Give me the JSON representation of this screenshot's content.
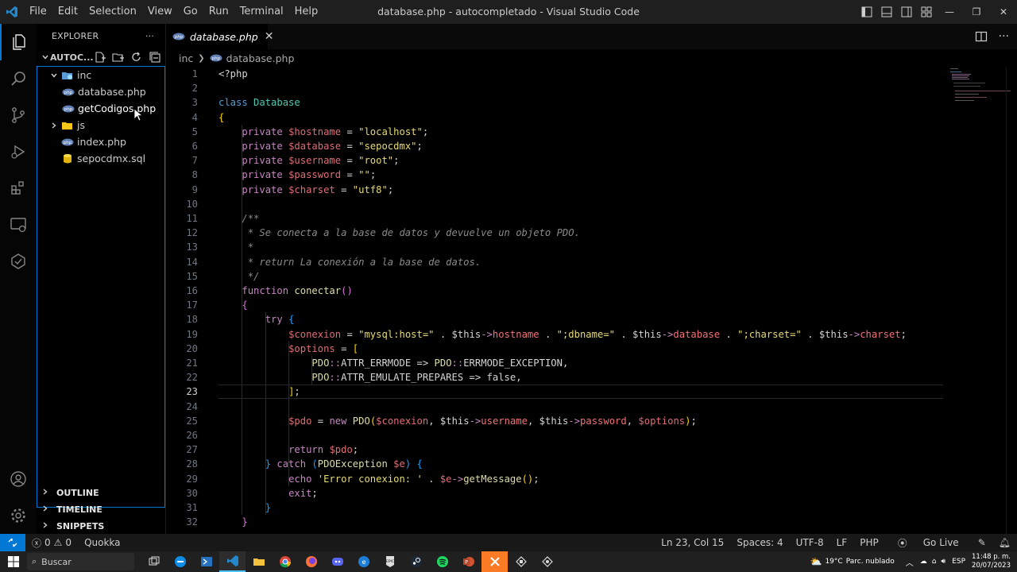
{
  "window": {
    "title": "database.php - autocompletado - Visual Studio Code",
    "menu": [
      "File",
      "Edit",
      "Selection",
      "View",
      "Go",
      "Run",
      "Terminal",
      "Help"
    ]
  },
  "sidebar": {
    "header": "EXPLORER",
    "more": "···",
    "folder": "AUTOC...",
    "tree": [
      {
        "label": "inc",
        "type": "folder",
        "expanded": true,
        "indent": 1
      },
      {
        "label": "database.php",
        "type": "php",
        "indent": 2
      },
      {
        "label": "getCodigos.php",
        "type": "php",
        "indent": 2,
        "selected": true
      },
      {
        "label": "js",
        "type": "folder",
        "expanded": false,
        "indent": 1
      },
      {
        "label": "index.php",
        "type": "php",
        "indent": 1
      },
      {
        "label": "sepocdmx.sql",
        "type": "sql",
        "indent": 1
      }
    ],
    "panels": [
      "OUTLINE",
      "TIMELINE",
      "SNIPPETS"
    ]
  },
  "editor": {
    "tab": "database.php",
    "breadcrumb": [
      "inc",
      "database.php"
    ],
    "current_line": 23,
    "lines": [
      {
        "n": "1",
        "tokens": [
          [
            "pl",
            "<?php"
          ]
        ]
      },
      {
        "n": "2",
        "tokens": []
      },
      {
        "n": "3",
        "tokens": [
          [
            "kb",
            "class "
          ],
          [
            "cls",
            "Database"
          ]
        ]
      },
      {
        "n": "4",
        "tokens": [
          [
            "br1",
            "{"
          ]
        ]
      },
      {
        "n": "5",
        "tokens": [
          [
            "pl",
            "    "
          ],
          [
            "kw",
            "private "
          ],
          [
            "var",
            "$hostname"
          ],
          [
            "pl",
            " = "
          ],
          [
            "strw",
            "\"localhost\""
          ],
          [
            "pl",
            ";"
          ]
        ]
      },
      {
        "n": "6",
        "tokens": [
          [
            "pl",
            "    "
          ],
          [
            "kw",
            "private "
          ],
          [
            "var",
            "$database"
          ],
          [
            "pl",
            " = "
          ],
          [
            "strw",
            "\"sepocdmx\""
          ],
          [
            "pl",
            ";"
          ]
        ]
      },
      {
        "n": "7",
        "tokens": [
          [
            "pl",
            "    "
          ],
          [
            "kw",
            "private "
          ],
          [
            "var",
            "$username"
          ],
          [
            "pl",
            " = "
          ],
          [
            "strw",
            "\"root\""
          ],
          [
            "pl",
            ";"
          ]
        ]
      },
      {
        "n": "8",
        "tokens": [
          [
            "pl",
            "    "
          ],
          [
            "kw",
            "private "
          ],
          [
            "var",
            "$password"
          ],
          [
            "pl",
            " = "
          ],
          [
            "strw",
            "\"\""
          ],
          [
            "pl",
            ";"
          ]
        ]
      },
      {
        "n": "9",
        "tokens": [
          [
            "pl",
            "    "
          ],
          [
            "kw",
            "private "
          ],
          [
            "var",
            "$charset"
          ],
          [
            "pl",
            " = "
          ],
          [
            "strw",
            "\"utf8\""
          ],
          [
            "pl",
            ";"
          ]
        ]
      },
      {
        "n": "10",
        "tokens": []
      },
      {
        "n": "11",
        "tokens": [
          [
            "pl",
            "    "
          ],
          [
            "cmg",
            "/**"
          ]
        ]
      },
      {
        "n": "12",
        "tokens": [
          [
            "pl",
            "     "
          ],
          [
            "cmg",
            "* Se conecta a la base de datos y devuelve un objeto PDO."
          ]
        ]
      },
      {
        "n": "13",
        "tokens": [
          [
            "pl",
            "     "
          ],
          [
            "cmg",
            "*"
          ]
        ]
      },
      {
        "n": "14",
        "tokens": [
          [
            "pl",
            "     "
          ],
          [
            "cmg",
            "* return La conexión a la base de datos."
          ]
        ]
      },
      {
        "n": "15",
        "tokens": [
          [
            "pl",
            "     "
          ],
          [
            "cmg",
            "*/"
          ]
        ]
      },
      {
        "n": "16",
        "tokens": [
          [
            "pl",
            "    "
          ],
          [
            "kw",
            "function "
          ],
          [
            "fn",
            "conectar"
          ],
          [
            "br2",
            "()"
          ]
        ]
      },
      {
        "n": "17",
        "tokens": [
          [
            "pl",
            "    "
          ],
          [
            "br2",
            "{"
          ]
        ]
      },
      {
        "n": "18",
        "tokens": [
          [
            "pl",
            "        "
          ],
          [
            "kw",
            "try "
          ],
          [
            "br3",
            "{"
          ]
        ]
      },
      {
        "n": "19",
        "tokens": [
          [
            "pl",
            "            "
          ],
          [
            "var",
            "$conexion"
          ],
          [
            "pl",
            " = "
          ],
          [
            "strw",
            "\"mysql:host=\""
          ],
          [
            "pl",
            " . "
          ],
          [
            "pl",
            "$this"
          ],
          [
            "kw",
            "->"
          ],
          [
            "ph",
            "hostname"
          ],
          [
            "pl",
            " . "
          ],
          [
            "strw",
            "\";dbname=\""
          ],
          [
            "pl",
            " . "
          ],
          [
            "pl",
            "$this"
          ],
          [
            "kw",
            "->"
          ],
          [
            "ph",
            "database"
          ],
          [
            "pl",
            " . "
          ],
          [
            "strw",
            "\";charset=\""
          ],
          [
            "pl",
            " . "
          ],
          [
            "pl",
            "$this"
          ],
          [
            "kw",
            "->"
          ],
          [
            "ph",
            "charset"
          ],
          [
            "pl",
            ";"
          ]
        ]
      },
      {
        "n": "20",
        "tokens": [
          [
            "pl",
            "            "
          ],
          [
            "var",
            "$options"
          ],
          [
            "pl",
            " = "
          ],
          [
            "br1",
            "["
          ]
        ]
      },
      {
        "n": "21",
        "tokens": [
          [
            "pl",
            "                "
          ],
          [
            "pdo",
            "PDO"
          ],
          [
            "kw",
            "::"
          ],
          [
            "pl",
            "ATTR_ERRMODE => "
          ],
          [
            "pdo",
            "PDO"
          ],
          [
            "kw",
            "::"
          ],
          [
            "pl",
            "ERRMODE_EXCEPTION,"
          ]
        ]
      },
      {
        "n": "22",
        "tokens": [
          [
            "pl",
            "                "
          ],
          [
            "pdo",
            "PDO"
          ],
          [
            "kw",
            "::"
          ],
          [
            "pl",
            "ATTR_EMULATE_PREPARES => false,"
          ]
        ]
      },
      {
        "n": "23",
        "tokens": [
          [
            "pl",
            "            "
          ],
          [
            "br1",
            "]"
          ],
          [
            "pl",
            ";"
          ]
        ]
      },
      {
        "n": "24",
        "tokens": []
      },
      {
        "n": "25",
        "tokens": [
          [
            "pl",
            "            "
          ],
          [
            "var",
            "$pdo"
          ],
          [
            "pl",
            " = "
          ],
          [
            "kw",
            "new "
          ],
          [
            "pdo",
            "PDO"
          ],
          [
            "br1",
            "("
          ],
          [
            "var",
            "$conexion"
          ],
          [
            "pl",
            ", "
          ],
          [
            "pl",
            "$this"
          ],
          [
            "kw",
            "->"
          ],
          [
            "ph",
            "username"
          ],
          [
            "pl",
            ", "
          ],
          [
            "pl",
            "$this"
          ],
          [
            "kw",
            "->"
          ],
          [
            "ph",
            "password"
          ],
          [
            "pl",
            ", "
          ],
          [
            "var",
            "$options"
          ],
          [
            "br1",
            ")"
          ],
          [
            "pl",
            ";"
          ]
        ]
      },
      {
        "n": "26",
        "tokens": []
      },
      {
        "n": "27",
        "tokens": [
          [
            "pl",
            "            "
          ],
          [
            "kw",
            "return "
          ],
          [
            "var",
            "$pdo"
          ],
          [
            "pl",
            ";"
          ]
        ]
      },
      {
        "n": "28",
        "tokens": [
          [
            "pl",
            "        "
          ],
          [
            "br3",
            "}"
          ],
          [
            "kw",
            " catch "
          ],
          [
            "br3",
            "("
          ],
          [
            "pdo",
            "PDOException "
          ],
          [
            "var",
            "$e"
          ],
          [
            "br3",
            ")"
          ],
          [
            "pl",
            " "
          ],
          [
            "br3",
            "{"
          ]
        ]
      },
      {
        "n": "29",
        "tokens": [
          [
            "pl",
            "            "
          ],
          [
            "kw",
            "echo "
          ],
          [
            "strw",
            "'Error conexion: '"
          ],
          [
            "pl",
            " . "
          ],
          [
            "var",
            "$e"
          ],
          [
            "kw",
            "->"
          ],
          [
            "fn",
            "getMessage"
          ],
          [
            "br1",
            "()"
          ],
          [
            "pl",
            ";"
          ]
        ]
      },
      {
        "n": "30",
        "tokens": [
          [
            "pl",
            "            "
          ],
          [
            "kw",
            "exit"
          ],
          [
            "pl",
            ";"
          ]
        ]
      },
      {
        "n": "31",
        "tokens": [
          [
            "pl",
            "        "
          ],
          [
            "br3",
            "}"
          ]
        ]
      },
      {
        "n": "32",
        "tokens": [
          [
            "pl",
            "    "
          ],
          [
            "br2",
            "}"
          ]
        ]
      }
    ]
  },
  "statusbar": {
    "errors": "0",
    "warnings": "0",
    "quokka": "Quokka",
    "position": "Ln 23, Col 15",
    "spaces": "Spaces: 4",
    "encoding": "UTF-8",
    "eol": "LF",
    "language": "PHP",
    "golive": "Go Live"
  },
  "taskbar": {
    "search": "Buscar",
    "weather_temp": "19°C",
    "weather_desc": "Parc. nublado",
    "lang": "ESP",
    "time": "11:48 p. m.",
    "date": "20/07/2023"
  },
  "colors": {
    "accent": "#0078d4",
    "statusbar": "#181818",
    "editor_bg": "#000000"
  }
}
